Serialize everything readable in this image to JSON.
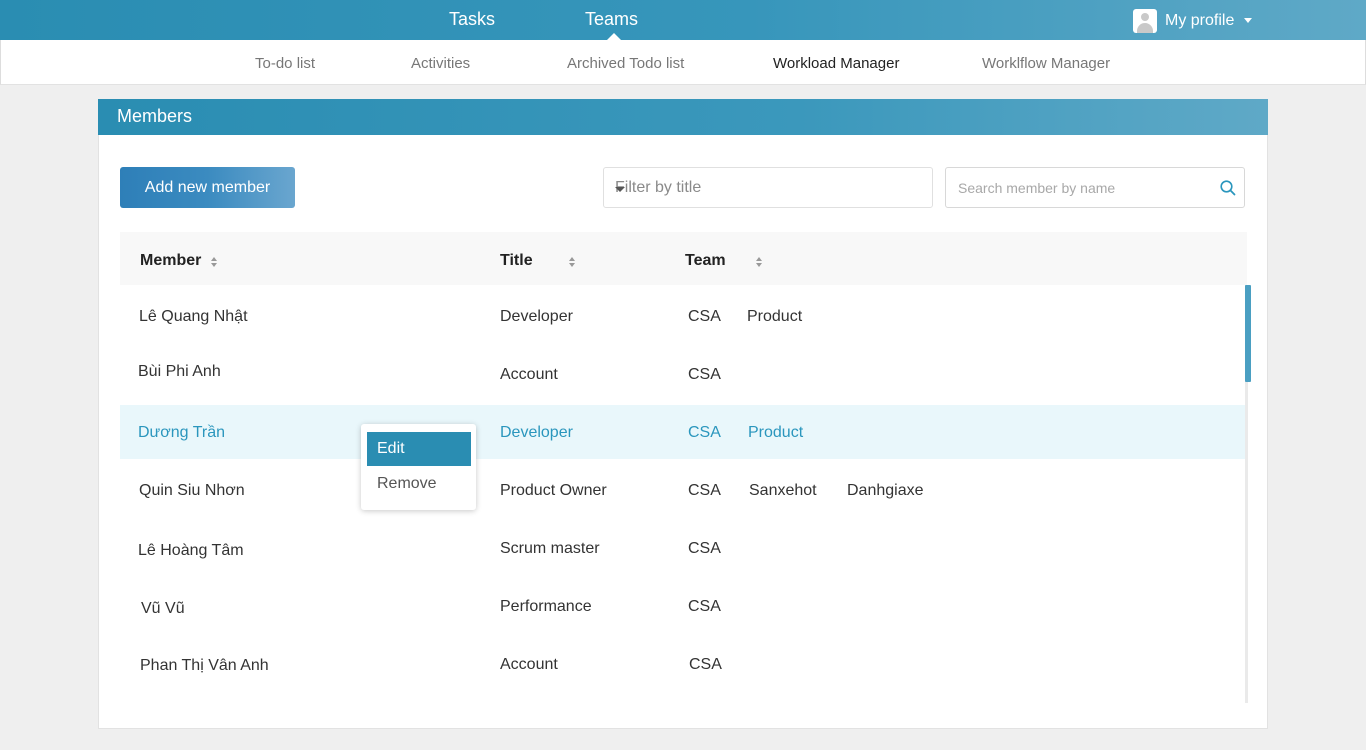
{
  "topbar": {
    "nav": [
      {
        "label": "Tasks"
      },
      {
        "label": "Teams"
      }
    ],
    "profile_label": "My profile"
  },
  "subnav": {
    "items": [
      {
        "label": "To-do list"
      },
      {
        "label": "Activities"
      },
      {
        "label": "Archived Todo list"
      },
      {
        "label": "Workload Manager",
        "active": true
      },
      {
        "label": "Worklflow Manager"
      }
    ]
  },
  "panel": {
    "title": "Members",
    "add_button_label": "Add new member",
    "filter_placeholder": "Filter by title",
    "search_placeholder": "Search member by name"
  },
  "table": {
    "columns": [
      {
        "label": "Member"
      },
      {
        "label": "Title"
      },
      {
        "label": "Team"
      }
    ],
    "rows": [
      {
        "member": "Lê Quang Nhật",
        "title": "Developer",
        "teams": [
          "CSA",
          "Product"
        ]
      },
      {
        "member": "Bùi Phi Anh",
        "title": "Account",
        "teams": [
          "CSA"
        ]
      },
      {
        "member": "Dương Trần",
        "title": "Developer",
        "teams": [
          "CSA",
          "Product"
        ],
        "selected": true
      },
      {
        "member": "Quin Siu Nhơn",
        "title": "Product Owner",
        "teams": [
          "CSA",
          "Sanxehot",
          "Danhgiaxe"
        ]
      },
      {
        "member": "Lê Hoàng Tâm",
        "title": "Scrum master",
        "teams": [
          "CSA"
        ]
      },
      {
        "member": "Vũ Vũ",
        "title": "Performance",
        "teams": [
          "CSA"
        ]
      },
      {
        "member": "Phan Thị Vân Anh",
        "title": "Account",
        "teams": [
          "CSA"
        ]
      }
    ]
  },
  "context_menu": {
    "items": [
      {
        "label": "Edit",
        "active": true
      },
      {
        "label": "Remove"
      }
    ]
  },
  "colors": {
    "accent": "#2a8db2",
    "selected_row_bg": "#e9f7fb",
    "selected_text": "#2a96bd"
  }
}
